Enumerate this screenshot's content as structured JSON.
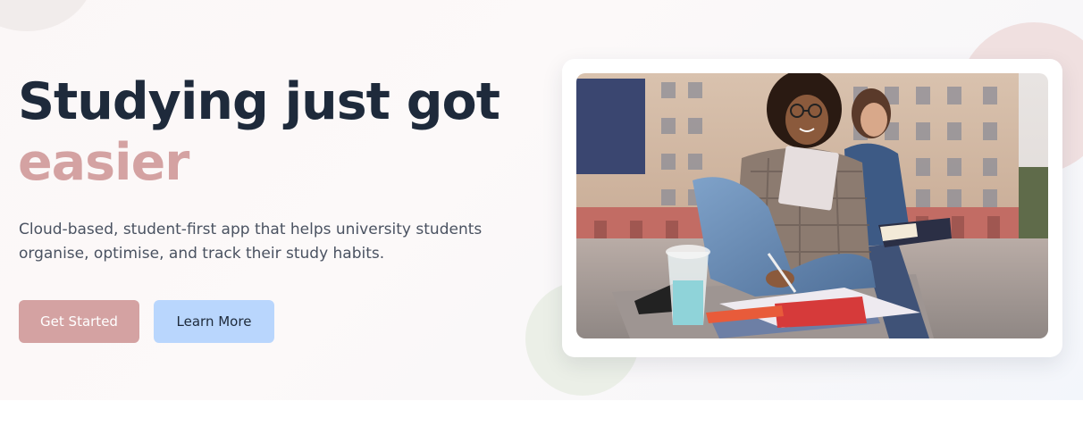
{
  "hero": {
    "headline_line1": "Studying just got",
    "headline_accent": "easier",
    "subtitle": "Cloud-based, student-first app that helps university students organise, optimise, and track their study habits.",
    "primary_button": "Get Started",
    "secondary_button": "Learn More"
  },
  "image": {
    "subject": "students-studying-photo"
  },
  "colors": {
    "heading": "#1e2a3b",
    "accent": "#d4a2a2",
    "primary_button_bg": "#d4a2a2",
    "secondary_button_bg": "#b9d6fd",
    "body_text": "#4a5261"
  }
}
